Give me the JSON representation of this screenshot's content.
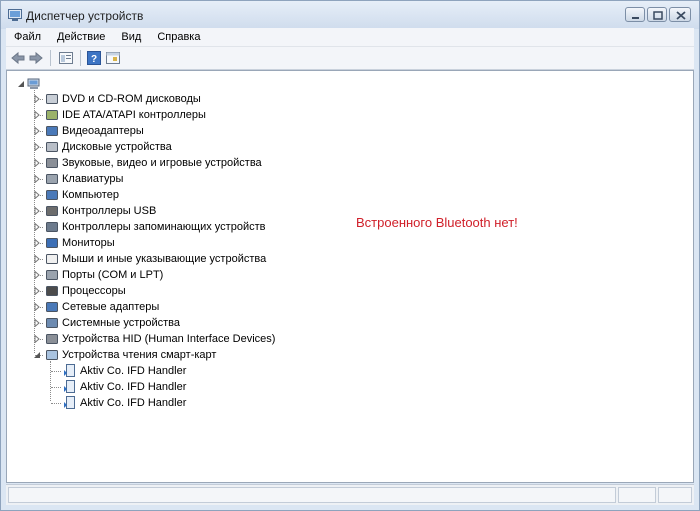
{
  "window": {
    "title": "Диспетчер устройств"
  },
  "menu": [
    "Файл",
    "Действие",
    "Вид",
    "Справка"
  ],
  "toolbar": {
    "icons": [
      "back-arrow-icon",
      "forward-arrow-icon",
      "properties-icon",
      "help-icon",
      "scan-hardware-icon"
    ]
  },
  "tree": {
    "categories": [
      "DVD и CD-ROM дисководы",
      "IDE ATA/ATAPI контроллеры",
      "Видеоадаптеры",
      "Дисковые устройства",
      "Звуковые, видео и игровые устройства",
      "Клавиатуры",
      "Компьютер",
      "Контроллеры USB",
      "Контроллеры запоминающих устройств",
      "Мониторы",
      "Мыши и иные указывающие устройства",
      "Порты (COM и LPT)",
      "Процессоры",
      "Сетевые адаптеры",
      "Системные устройства",
      "Устройства HID (Human Interface Devices)",
      "Устройства чтения смарт-карт"
    ],
    "smart_card_devices": [
      "Aktiv Co. IFD Handler",
      "Aktiv Co. IFD Handler",
      "Aktiv Co. IFD Handler"
    ]
  },
  "annotation": "Встроенного Bluetooth нет!",
  "colors": {
    "annotation": "#d0202a",
    "frame": "#dbe6f3",
    "accent": "#3c74c4"
  }
}
